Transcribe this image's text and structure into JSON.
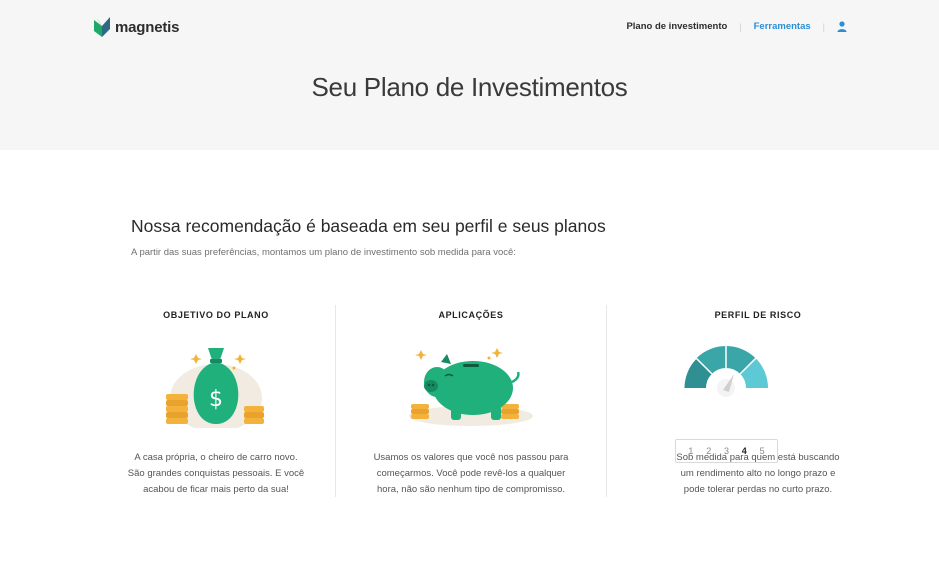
{
  "brand": {
    "name": "magnetis",
    "logo_icon": "magnetis-logo-icon"
  },
  "nav": {
    "items": [
      {
        "label": "Plano de investimento",
        "active": false
      },
      {
        "label": "Ferramentas",
        "active": true
      }
    ],
    "user_icon": "user-icon",
    "accent_color": "#2a8fd6"
  },
  "hero": {
    "title": "Seu Plano de Investimentos"
  },
  "recommendation": {
    "title": "Nossa recomendação é baseada em seu perfil e seus planos",
    "subtitle": "A partir das suas preferências, montamos um plano de investimento sob medida para você:"
  },
  "columns": [
    {
      "title": "OBJETIVO DO PLANO",
      "icon": "money-bag-icon",
      "desc": [
        "A casa própria, o cheiro de carro novo.",
        "São grandes conquistas pessoais. E você",
        "acabou de ficar mais perto da sua!"
      ]
    },
    {
      "title": "APLICAÇÕES",
      "icon": "piggy-bank-icon",
      "desc": [
        "Usamos os valores que você nos passou para",
        "começarmos. Você pode revê-los a qualquer",
        "hora, não são nenhum tipo de compromisso."
      ]
    },
    {
      "title": "PERFIL DE RISCO",
      "icon": "risk-gauge-icon",
      "scale": [
        "1",
        "2",
        "3",
        "4",
        "5"
      ],
      "selected_level": 4,
      "desc": [
        "Sob medida para quem está buscando",
        "um rendimento alto no longo prazo e",
        "pode tolerar perdas no curto prazo."
      ]
    }
  ],
  "colors": {
    "primary_green": "#1fb07c",
    "teal": "#3aa6a8",
    "coin_gold": "#f3b23c"
  }
}
